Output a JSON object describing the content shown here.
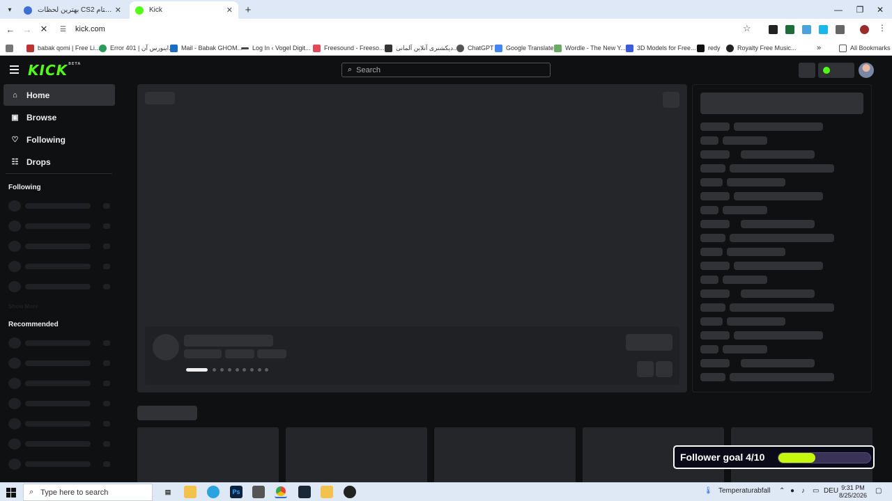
{
  "browser": {
    "tabs": [
      {
        "title": "بهترین لحظات CS2 کنار دوستام |",
        "active": false
      },
      {
        "title": "Kick",
        "active": true
      }
    ],
    "url": "kick.com",
    "bookmarks": [
      "babak qomi | Free Li...",
      "Error 401 | اینورس آن...",
      "Mail - Babak GHOM...",
      "Log In ‹ Vogel Digit...",
      "Freesound - Freeso...",
      "دیکشنری آنلاین آلمانی...",
      "ChatGPT",
      "Google Translate",
      "Wordle - The New Y...",
      "3D Models for Free...",
      "redy",
      "Royalty Free Music..."
    ],
    "all_bookmarks_label": "All Bookmarks"
  },
  "kick": {
    "logo": "KICK",
    "logo_badge": "BETA",
    "search_placeholder": "Search",
    "nav": [
      {
        "label": "Home",
        "icon": "home-icon",
        "selected": true
      },
      {
        "label": "Browse",
        "icon": "browse-icon",
        "selected": false
      },
      {
        "label": "Following",
        "icon": "heart-icon",
        "selected": false
      },
      {
        "label": "Drops",
        "icon": "drops-icon",
        "selected": false
      }
    ],
    "following_heading": "Following",
    "show_more": "Show More",
    "recommended_heading": "Recommended",
    "colors": {
      "accent": "#53fc18",
      "background": "#0f1011",
      "skeleton": "#303236"
    }
  },
  "overlay": {
    "goal_label": "Follower goal 4/10",
    "goal_progress": 0.4,
    "fill_color": "#c6f80e"
  },
  "taskbar": {
    "search_placeholder": "Type here to search",
    "weather": "Temperaturabfall",
    "language": "DEU",
    "time": "9:31 PM",
    "date": "8/25/2026"
  }
}
